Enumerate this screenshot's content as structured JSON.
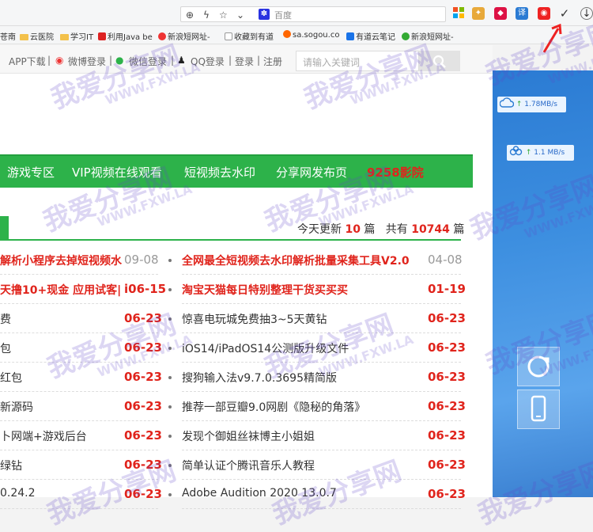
{
  "browser": {
    "address_placeholder": "百度",
    "bookmarks": [
      "苍南",
      "云医院",
      "学习IT",
      "利用Java be",
      "新浪短网址-",
      "收藏到有道",
      "sa.sogou.co",
      "有道云笔记",
      "新浪短网址-"
    ],
    "extension_icons": [
      "windows-icon",
      "puzzle-icon",
      "cube-icon",
      "translate-icon",
      "pocket-icon",
      "check-icon",
      "download-icon"
    ],
    "translate_label": "译"
  },
  "top_bar": {
    "app_download": "APP下载",
    "weibo_login": "微博登录",
    "wechat_login": "微信登录",
    "qq_login": "QQ登录",
    "login": "登录",
    "register": "注册",
    "separator": "|",
    "search_placeholder": "请输入关键词"
  },
  "nav": {
    "items": [
      "游戏专区",
      "VIP视频在线观看",
      "短视频去水印",
      "分享网发布页",
      "9258影院"
    ]
  },
  "stats": {
    "today_prefix": "今天更新",
    "today_count": "10",
    "unit": "篇",
    "total_prefix": "共有",
    "total_count": "10744"
  },
  "sidebar": {
    "download_speed": "1.78MB/s",
    "upload_speed": "1.1 MB/s"
  },
  "articles_left": [
    {
      "title": "解析小程序去掉短视频水",
      "date": "09-08",
      "hot": true,
      "grey_date": true
    },
    {
      "title": "天撸10+现金 应用试客|",
      "date": "i06-15",
      "hot": true,
      "grey_date": false
    },
    {
      "title": "费",
      "date": "06-23",
      "hot": false,
      "grey_date": false
    },
    {
      "title": "包",
      "date": "06-23",
      "hot": false,
      "grey_date": false
    },
    {
      "title": "红包",
      "date": "06-23",
      "hot": false,
      "grey_date": false
    },
    {
      "title": "新源码",
      "date": "06-23",
      "hot": false,
      "grey_date": false
    },
    {
      "title": "卜网端+游戏后台",
      "date": "06-23",
      "hot": false,
      "grey_date": false
    },
    {
      "title": "绿钻",
      "date": "06-23",
      "hot": false,
      "grey_date": false
    },
    {
      "title": "0.24.2",
      "date": "06-23",
      "hot": false,
      "grey_date": false
    }
  ],
  "articles_right": [
    {
      "title": "全网最全短视频去水印解析批量采集工具V2.0",
      "date": "04-08",
      "hot": true,
      "grey_date": true
    },
    {
      "title": "淘宝天猫每日特别整理干货买买买",
      "date": "01-19",
      "hot": true,
      "grey_date": false
    },
    {
      "title": "惊喜电玩城免费抽3~5天黄钻",
      "date": "06-23",
      "hot": false,
      "grey_date": false
    },
    {
      "title": "iOS14/iPadOS14公测版升级文件",
      "date": "06-23",
      "hot": false,
      "grey_date": false
    },
    {
      "title": "搜狗输入法v9.7.0.3695精简版",
      "date": "06-23",
      "hot": false,
      "grey_date": false
    },
    {
      "title": "推荐一部豆瓣9.0网剧《隐秘的角落》",
      "date": "06-23",
      "hot": false,
      "grey_date": false
    },
    {
      "title": "发现个御姐丝袜博主小姐姐",
      "date": "06-23",
      "hot": false,
      "grey_date": false
    },
    {
      "title": "简单认证个腾讯音乐人教程",
      "date": "06-23",
      "hot": false,
      "grey_date": false
    },
    {
      "title": "Adobe Audition 2020 13.0.7",
      "date": "06-23",
      "hot": false,
      "grey_date": false
    }
  ],
  "watermarks": [
    "我爱分享网",
    "WWW.FXW.LA"
  ]
}
